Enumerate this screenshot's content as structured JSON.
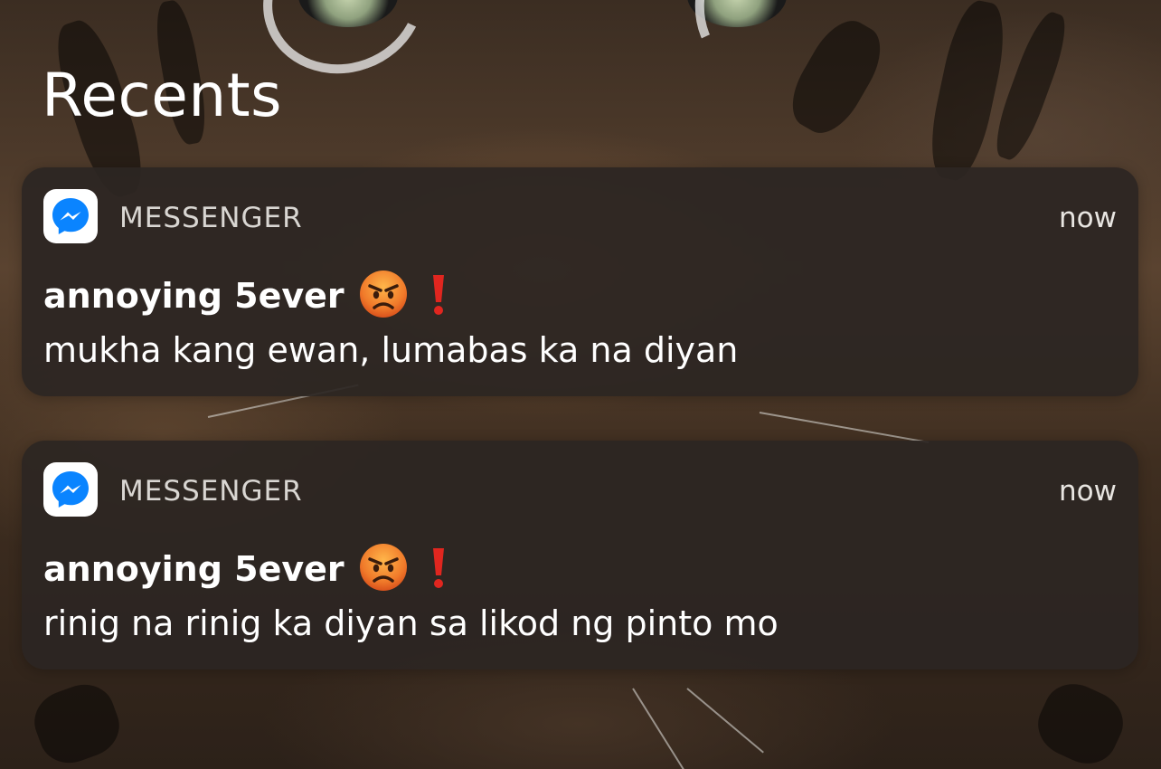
{
  "screen": {
    "title": "Recents"
  },
  "notifications": [
    {
      "app_name": "MESSENGER",
      "time": "now",
      "sender": "annoying 5ever",
      "sender_emojis": [
        "angry-face",
        "red-exclamation"
      ],
      "message": "mukha kang ewan, lumabas ka na diyan",
      "app_icon": "messenger-icon"
    },
    {
      "app_name": "MESSENGER",
      "time": "now",
      "sender": "annoying 5ever",
      "sender_emojis": [
        "angry-face",
        "red-exclamation"
      ],
      "message": "rinig na rinig ka diyan sa likod ng pinto mo",
      "app_icon": "messenger-icon"
    }
  ],
  "colors": {
    "messenger_blue": "#0a84ff",
    "card_background": "#2c2622",
    "text_primary": "#ffffff",
    "text_secondary": "#d9d6d2"
  }
}
